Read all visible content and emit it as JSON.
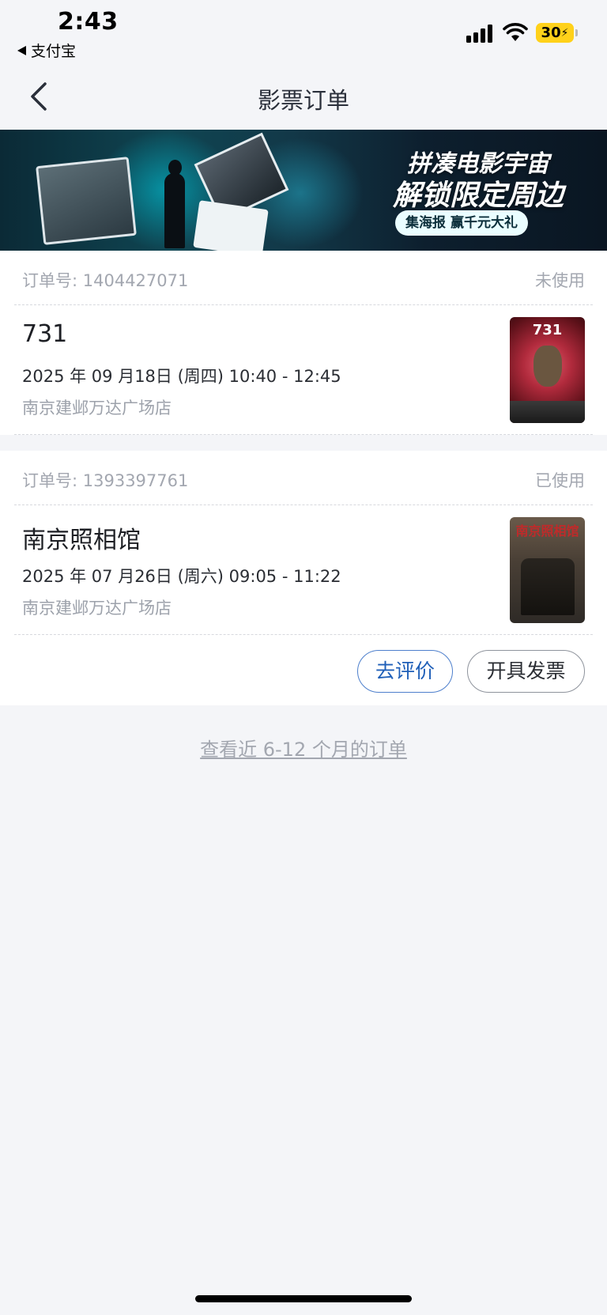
{
  "status_bar": {
    "time": "2:43",
    "back_app": "支付宝",
    "battery": "30",
    "icons": [
      "cellular-signal-icon",
      "wifi-icon",
      "battery-charging-icon"
    ]
  },
  "nav": {
    "title": "影票订单",
    "back_icon": "chevron-left-icon"
  },
  "banner": {
    "line1": "拼凑电影宇宙",
    "line2": "解锁限定周边",
    "pill": "集海报 赢千元大礼"
  },
  "orders": [
    {
      "order_no": "订单号: 1404427071",
      "status": "未使用",
      "title": "731",
      "time": "2025 年 09 月18日 (周四) 10:40 - 12:45",
      "cinema": "南京建邺万达广场店",
      "poster_text": "731"
    },
    {
      "order_no": "订单号: 1393397761",
      "status": "已使用",
      "title": "南京照相馆",
      "time": "2025 年 07 月26日 (周六) 09:05 - 11:22",
      "cinema": "南京建邺万达广场店",
      "poster_text": "南京照相馆",
      "actions": {
        "review": "去评价",
        "invoice": "开具发票"
      }
    }
  ],
  "more_link": "查看近 6-12 个月的订单",
  "colors": {
    "page_bg": "#f4f5f8",
    "muted_text": "#a3a7b0",
    "review_accent": "#1f5fb8"
  }
}
